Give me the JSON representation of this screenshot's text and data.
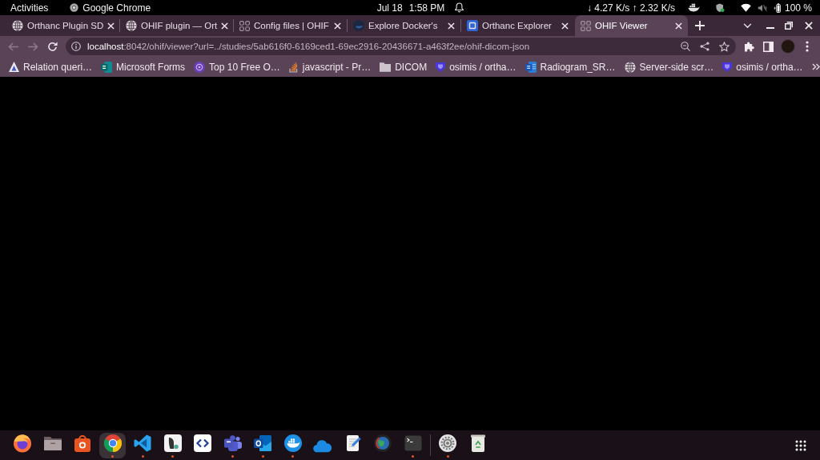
{
  "top_bar": {
    "activities": "Activities",
    "app_name": "Google Chrome",
    "date": "Jul 18",
    "time": "1:58 PM",
    "network": "↓ 4.27 K/s ↑ 2.32 K/s",
    "sound": {
      "muted": true
    },
    "battery": "100 %"
  },
  "tabs": [
    {
      "label": "Orthanc Plugin SD",
      "kind": "globe",
      "selected": false
    },
    {
      "label": "OHIF plugin — Ort",
      "kind": "globe",
      "selected": false
    },
    {
      "label": "Config files | OHIF",
      "kind": "grid",
      "selected": false
    },
    {
      "label": "Explore Docker's",
      "kind": "disc",
      "selected": false
    },
    {
      "label": "Orthanc Explorer",
      "kind": "square",
      "selected": false
    },
    {
      "label": "OHIF Viewer",
      "kind": "grid",
      "selected": true
    }
  ],
  "toolbar": {
    "back": {
      "disabled": true
    },
    "forward": {
      "disabled": true
    },
    "address": {
      "host": "localhost",
      "path": ":8042/ohif/viewer?url=../studies/5ab616f0-6169ced1-69ec2916-20436671-a463f2ee/ohif-dicom-json"
    }
  },
  "bookmarks": [
    {
      "label": "Relation queri…",
      "kind": "triangle"
    },
    {
      "label": "Microsoft Forms",
      "kind": "formtile"
    },
    {
      "label": "Top 10 Free O…",
      "kind": "badge"
    },
    {
      "label": "javascript - Pr…",
      "kind": "stack"
    },
    {
      "label": "DICOM",
      "kind": "folder"
    },
    {
      "label": "osimis / ortha…",
      "kind": "shield"
    },
    {
      "label": "Radiogram_SR…",
      "kind": "doc"
    },
    {
      "label": "Server-side scr…",
      "kind": "globe"
    },
    {
      "label": "osimis / ortha…",
      "kind": "shield"
    }
  ],
  "dock": {
    "favorites": [
      {
        "kind": "fox",
        "running": false,
        "selected": false
      },
      {
        "kind": "folder",
        "running": false,
        "selected": false
      },
      {
        "kind": "bag",
        "running": false,
        "selected": false
      },
      {
        "kind": "chrome",
        "running": true,
        "selected": true
      },
      {
        "kind": "ribbon",
        "running": true,
        "selected": false
      },
      {
        "kind": "tile",
        "running": true,
        "selected": false
      },
      {
        "kind": "code",
        "running": false,
        "selected": false
      },
      {
        "kind": "people",
        "running": true,
        "selected": false
      },
      {
        "kind": "mail",
        "running": true,
        "selected": false
      },
      {
        "kind": "whale",
        "running": true,
        "selected": false
      },
      {
        "kind": "cloud",
        "running": false,
        "selected": false
      },
      {
        "kind": "notepad",
        "running": false,
        "selected": false
      },
      {
        "kind": "globe",
        "running": false,
        "selected": false
      },
      {
        "kind": "terminal",
        "running": true,
        "selected": false
      }
    ],
    "others": [
      {
        "kind": "gear",
        "running": true,
        "selected": false
      },
      {
        "kind": "trash",
        "running": false,
        "selected": false
      }
    ]
  }
}
